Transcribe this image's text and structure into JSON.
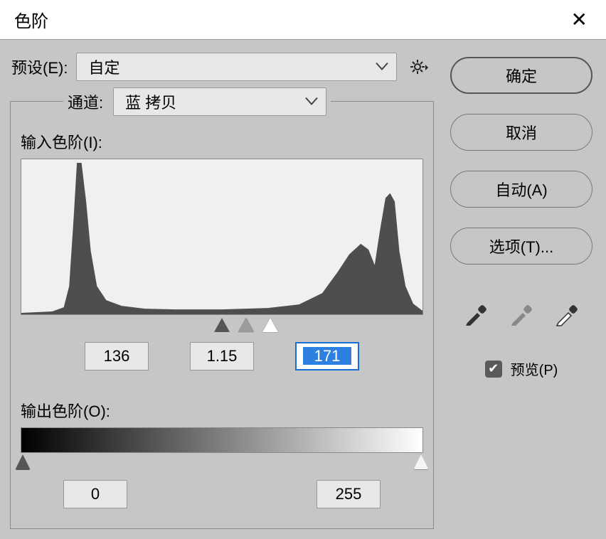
{
  "dialog": {
    "title": "色阶"
  },
  "preset": {
    "label": "预设(E):",
    "value": "自定"
  },
  "channel": {
    "label": "通道:",
    "value": "蓝 拷贝"
  },
  "input_levels": {
    "label": "输入色阶(I):",
    "black": "136",
    "gamma": "1.15",
    "white": "171"
  },
  "output_levels": {
    "label": "输出色阶(O):",
    "black": "0",
    "white": "255"
  },
  "buttons": {
    "ok": "确定",
    "cancel": "取消",
    "auto": "自动(A)",
    "options": "选项(T)..."
  },
  "preview": {
    "label": "预览(P)",
    "checked": true
  },
  "chart_data": {
    "type": "area",
    "title": "",
    "xlabel": "",
    "ylabel": "",
    "x_range": [
      0,
      255
    ],
    "description": "Image histogram for blue-copy channel showing pixel frequency per tonal value",
    "peaks": [
      {
        "x": 50,
        "relative_height": 1.0,
        "note": "tall narrow spike in shadows"
      },
      {
        "x": 200,
        "relative_height": 0.45,
        "note": "broad bump in upper midtones"
      },
      {
        "x": 225,
        "relative_height": 0.68,
        "note": "sharp spike near highlights"
      }
    ],
    "input_sliders": {
      "black": 136,
      "gamma": 1.15,
      "white": 171
    },
    "output_sliders": {
      "black": 0,
      "white": 255
    }
  }
}
